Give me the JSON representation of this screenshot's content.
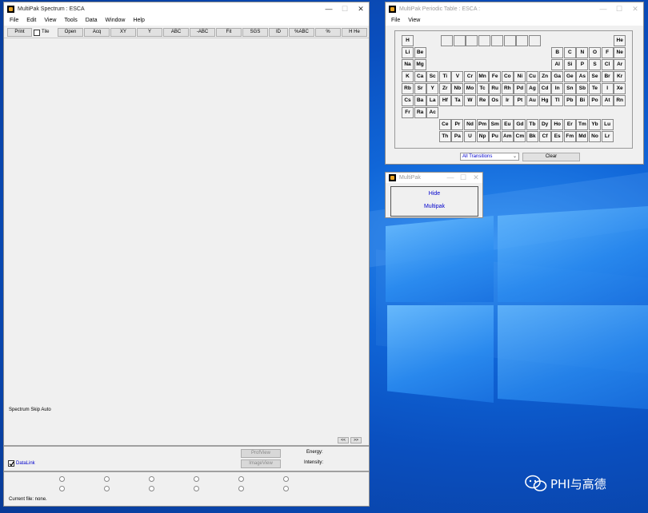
{
  "spectrum_window": {
    "title": "MultiPak Spectrum : ESCA",
    "menu": [
      "File",
      "Edit",
      "View",
      "Tools",
      "Data",
      "Window",
      "Help"
    ],
    "toolbar": {
      "print": "Print",
      "tile": "Tile",
      "buttons": [
        "Open",
        "Acq",
        "XY",
        "Y",
        "ABC",
        "-ABC",
        "Fit",
        "SGS",
        "ID",
        "%ABC",
        "%",
        "H He"
      ]
    },
    "skip_label": "Spectrum Skip Auto",
    "nav_prev": "<<",
    "nav_next": ">>",
    "datalink": "DataLink",
    "datalink_checked": true,
    "profview": "ProfView",
    "imageview": "ImageView",
    "energy_label": "Energy:",
    "intensity_label": "Intensity:",
    "current_file": "Current file: none."
  },
  "periodic_window": {
    "title": "MultiPak Periodic Table : ESCA :",
    "menu": [
      "File",
      "View"
    ],
    "main_rows": [
      [
        "H",
        "",
        "",
        "",
        "",
        "",
        "",
        "",
        "",
        "",
        "",
        "",
        "",
        "",
        "",
        "",
        "",
        "He"
      ],
      [
        "Li",
        "Be",
        "",
        "",
        "",
        "",
        "",
        "",
        "",
        "",
        "",
        "",
        "B",
        "C",
        "N",
        "O",
        "F",
        "Ne"
      ],
      [
        "Na",
        "Mg",
        "",
        "",
        "",
        "",
        "",
        "",
        "",
        "",
        "",
        "",
        "Al",
        "Si",
        "P",
        "S",
        "Cl",
        "Ar"
      ],
      [
        "K",
        "Ca",
        "Sc",
        "Ti",
        "V",
        "Cr",
        "Mn",
        "Fe",
        "Co",
        "Ni",
        "Cu",
        "Zn",
        "Ga",
        "Ge",
        "As",
        "Se",
        "Br",
        "Kr"
      ],
      [
        "Rb",
        "Sr",
        "Y",
        "Zr",
        "Nb",
        "Mo",
        "Tc",
        "Ru",
        "Rh",
        "Pd",
        "Ag",
        "Cd",
        "In",
        "Sn",
        "Sb",
        "Te",
        "I",
        "Xe"
      ],
      [
        "Cs",
        "Ba",
        "La",
        "Hf",
        "Ta",
        "W",
        "Re",
        "Os",
        "Ir",
        "Pt",
        "Au",
        "Hg",
        "Tl",
        "Pb",
        "Bi",
        "Po",
        "At",
        "Rn"
      ],
      [
        "Fr",
        "Ra",
        "Ac",
        "",
        "",
        "",
        "",
        "",
        "",
        "",
        "",
        "",
        "",
        "",
        "",
        "",
        "",
        ""
      ]
    ],
    "lanthanides": [
      "Ce",
      "Pr",
      "Nd",
      "Pm",
      "Sm",
      "Eu",
      "Gd",
      "Tb",
      "Dy",
      "Ho",
      "Er",
      "Tm",
      "Yb",
      "Lu"
    ],
    "actinides": [
      "Th",
      "Pa",
      "U",
      "Np",
      "Pu",
      "Am",
      "Cm",
      "Bk",
      "Cf",
      "Es",
      "Fm",
      "Md",
      "No",
      "Lr"
    ],
    "transitions_select": "All Transitions",
    "clear": "Clear"
  },
  "multipak_popup": {
    "title": "MultiPak",
    "hide": "Hide",
    "multipak": "Multipak"
  },
  "watermark": "PHI与高德",
  "colors": {
    "desktop": "#0a56c7",
    "link_blue": "#0000cc",
    "window_bg": "#f0f0f0"
  }
}
